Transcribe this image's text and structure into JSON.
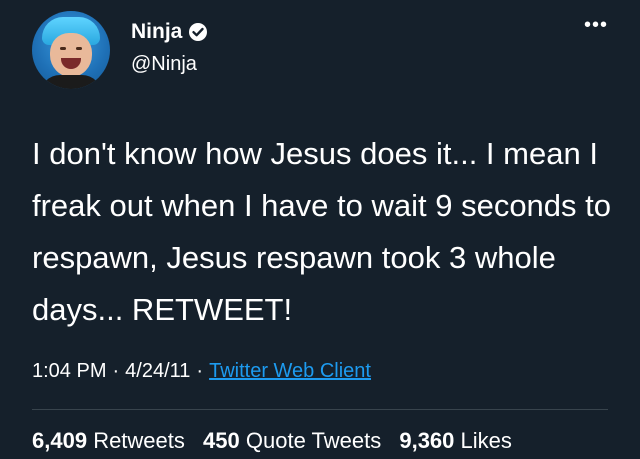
{
  "user": {
    "display_name": "Ninja",
    "handle": "@Ninja",
    "verified": true
  },
  "icons": {
    "verified": "verified-badge-icon",
    "more": "more-options-icon"
  },
  "more_glyph": "•••",
  "tweet": {
    "text": "I don't know how Jesus does it... I mean I freak out when I have to wait 9 seconds to respawn, Jesus respawn took 3 whole days... RETWEET!"
  },
  "meta": {
    "time": "1:04 PM",
    "date": "4/24/11",
    "separator": "·",
    "client": "Twitter Web Client"
  },
  "stats": {
    "retweets_count": "6,409",
    "retweets_label": "Retweets",
    "quotes_count": "450",
    "quotes_label": "Quote Tweets",
    "likes_count": "9,360",
    "likes_label": "Likes"
  },
  "colors": {
    "background": "#15202b",
    "link": "#1d9bf0",
    "divider": "#38444d"
  }
}
